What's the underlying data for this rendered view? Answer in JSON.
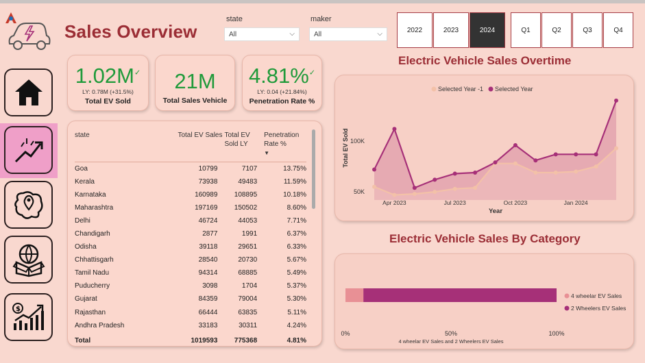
{
  "page_title": "Sales Overview",
  "filters": {
    "state": {
      "label": "state",
      "value": "All"
    },
    "maker": {
      "label": "maker",
      "value": "All"
    }
  },
  "years": [
    {
      "label": "2022",
      "selected": false
    },
    {
      "label": "2023",
      "selected": false
    },
    {
      "label": "2024",
      "selected": true
    }
  ],
  "quarters": [
    "Q1",
    "Q2",
    "Q3",
    "Q4"
  ],
  "kpis": [
    {
      "value": "1.02M",
      "check": "✓",
      "ly": "LY: 0.78M (+31.5%)",
      "label": "Total EV Sold"
    },
    {
      "value": "21M",
      "check": "",
      "ly": "",
      "label": "Total Sales Vehicle"
    },
    {
      "value": "4.81%",
      "check": "✓",
      "ly": "LY: 0.04 (+21.84%)",
      "label": "Penetration Rate %"
    }
  ],
  "table": {
    "headers": [
      "state",
      "Total EV Sales",
      "Total EV Sold LY",
      "Penetration Rate %"
    ],
    "sort_indicator": "▼",
    "rows": [
      [
        "Goa",
        "10799",
        "7107",
        "13.75%"
      ],
      [
        "Kerala",
        "73938",
        "49483",
        "11.59%"
      ],
      [
        "Karnataka",
        "160989",
        "108895",
        "10.18%"
      ],
      [
        "Maharashtra",
        "197169",
        "150502",
        "8.60%"
      ],
      [
        "Delhi",
        "46724",
        "44053",
        "7.71%"
      ],
      [
        "Chandigarh",
        "2877",
        "1991",
        "6.37%"
      ],
      [
        "Odisha",
        "39118",
        "29651",
        "6.33%"
      ],
      [
        "Chhattisgarh",
        "28540",
        "20730",
        "5.67%"
      ],
      [
        "Tamil Nadu",
        "94314",
        "68885",
        "5.49%"
      ],
      [
        "Puducherry",
        "3098",
        "1704",
        "5.37%"
      ],
      [
        "Gujarat",
        "84359",
        "79004",
        "5.30%"
      ],
      [
        "Rajasthan",
        "66444",
        "63835",
        "5.11%"
      ],
      [
        "Andhra Pradesh",
        "33183",
        "30311",
        "4.24%"
      ]
    ],
    "total": [
      "Total",
      "1019593",
      "775368",
      "4.81%"
    ]
  },
  "colors": {
    "title": "#9b2d35",
    "selected_year_series": "#a63078",
    "prev_year_series": "#f3c1a8",
    "area_fill": "#d98aa3",
    "two_wheeler": "#a63078",
    "four_wheeler": "#e89095",
    "kpi_value": "#1f9a3a"
  },
  "chart_data": [
    {
      "type": "area",
      "title": "Electric Vehicle Sales Overtime",
      "xlabel": "Year",
      "ylabel": "Total EV Sold",
      "x_ticks": [
        "Apr 2023",
        "Jul 2023",
        "Oct 2023",
        "Jan 2024"
      ],
      "y_ticks": [
        "50K",
        "100K"
      ],
      "ylim": [
        42000,
        150000
      ],
      "legend_position": "top",
      "x": [
        "Mar 2023",
        "Apr 2023",
        "May 2023",
        "Jun 2023",
        "Jul 2023",
        "Aug 2023",
        "Sep 2023",
        "Oct 2023",
        "Nov 2023",
        "Dec 2023",
        "Jan 2024",
        "Feb 2024",
        "Mar 2024"
      ],
      "series": [
        {
          "name": "Selected Year -1",
          "values": [
            55000,
            47000,
            48000,
            50000,
            53000,
            54000,
            78000,
            78000,
            69000,
            69000,
            70000,
            75000,
            93000
          ]
        },
        {
          "name": "Selected Year",
          "values": [
            72000,
            112000,
            54000,
            62000,
            68000,
            69000,
            79000,
            96000,
            81000,
            87000,
            87000,
            87000,
            140000
          ]
        }
      ]
    },
    {
      "type": "bar",
      "title": "Electric Vehicle Sales By Category",
      "orientation": "horizontal-stacked-100",
      "xlabel": "4 wheelar EV Sales and 2 Wheelers EV Sales",
      "x_ticks": [
        "0%",
        "50%",
        "100%"
      ],
      "legend_position": "right",
      "series": [
        {
          "name": "4 wheelar EV Sales",
          "values": [
            8.5
          ]
        },
        {
          "name": "2 Wheelers EV Sales",
          "values": [
            91.5
          ]
        }
      ]
    }
  ]
}
